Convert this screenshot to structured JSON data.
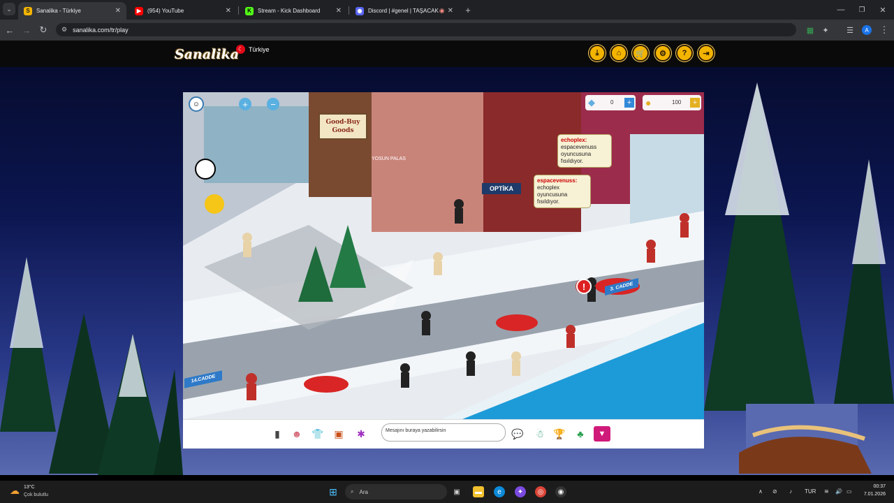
{
  "browser": {
    "tabs": [
      {
        "title": "Sanalika - Türkiye",
        "active": true,
        "icon": "sanalika-favicon"
      },
      {
        "title": "(954) YouTube",
        "active": false,
        "icon": "youtube-icon"
      },
      {
        "title": "Stream - Kick Dashboard",
        "active": false,
        "icon": "kick-icon"
      },
      {
        "title": "Discord | #genel | TAŞACAK",
        "active": false,
        "icon": "discord-icon"
      }
    ],
    "url": "sanalika.com/tr/play"
  },
  "site": {
    "logo": "Sanalika",
    "region": "Türkiye",
    "header_buttons": [
      "download-icon",
      "home-icon",
      "cart-icon",
      "gear-icon",
      "help-icon",
      "logout-icon"
    ]
  },
  "game": {
    "gems": "0",
    "coins": "100",
    "signs": {
      "shop": "Good-Buy Goods",
      "optika": "OPTİKA",
      "yosun": "YOSUN PALAS",
      "street1": "14.CADDE",
      "street2": "3. CADDE"
    },
    "bubbles": [
      {
        "name": "echoplex:",
        "text": "espacevenuss oyuncusuna fısıldıyor."
      },
      {
        "name": "espacevenuss:",
        "text": "echoplex oyuncusuna fısıldıyor."
      }
    ],
    "chat_placeholder": "Mesajını buraya yazabilirsin"
  },
  "taskbar": {
    "weather_temp": "13°C",
    "weather_desc": "Çok bulutlu",
    "search_label": "Ara",
    "lang": "TUR",
    "time": "00:37",
    "date": "7.01.2026"
  },
  "colors": {
    "accent": "#f3b400",
    "sea": "#1d9bd8"
  }
}
